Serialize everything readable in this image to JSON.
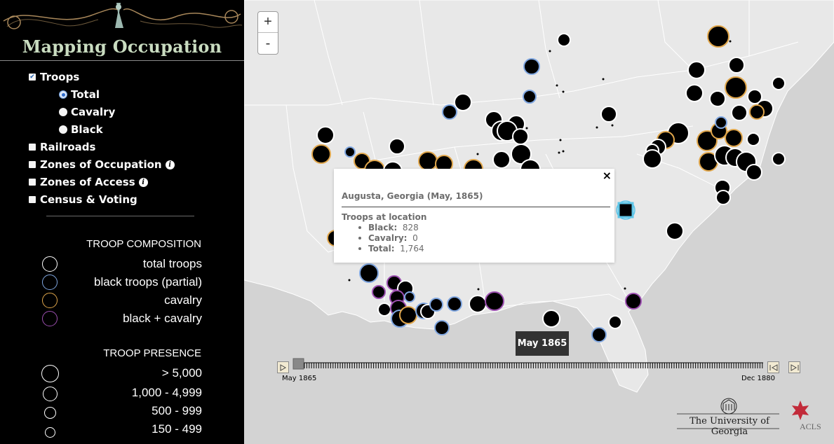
{
  "app": {
    "title": "Mapping Occupation"
  },
  "layers": {
    "troops": {
      "label": "Troops",
      "checked": true
    },
    "troop_options": [
      {
        "label": "Total",
        "selected": true
      },
      {
        "label": "Cavalry",
        "selected": false
      },
      {
        "label": "Black",
        "selected": false
      }
    ],
    "railroads": {
      "label": "Railroads",
      "checked": false
    },
    "zones_occupation": {
      "label": "Zones of Occupation",
      "checked": false,
      "info": "i"
    },
    "zones_access": {
      "label": "Zones of Access",
      "checked": false,
      "info": "i"
    },
    "census_voting": {
      "label": "Census & Voting",
      "checked": false
    }
  },
  "legend": {
    "composition_heading": "TROOP COMPOSITION",
    "composition": [
      {
        "label": "total troops",
        "color": "#ffffff"
      },
      {
        "label": "black troops (partial)",
        "color": "#7fa6e0"
      },
      {
        "label": "cavalry",
        "color": "#e0a64b"
      },
      {
        "label": "black + cavalry",
        "color": "#9c4fb0"
      }
    ],
    "presence_heading": "TROOP PRESENCE",
    "presence": [
      {
        "label": "> 5,000"
      },
      {
        "label": "1,000 - 4,999"
      },
      {
        "label": "500 - 999"
      },
      {
        "label": "150 - 499"
      }
    ]
  },
  "map": {
    "zoom_in": "+",
    "zoom_out": "-",
    "colors": {
      "land": "#e6e6e6",
      "water": "#cfcfcf",
      "border": "#ffffff",
      "marker": "#000000",
      "blue_ring": "#7fa6e0",
      "orange_ring": "#e0a64b",
      "purple_ring": "#9c4fb0",
      "white_ring": "#ffffff",
      "selected": "#5fc6e8"
    }
  },
  "popup": {
    "close": "×",
    "title": "Augusta, Georgia (May, 1865)",
    "subtitle": "Troops at location",
    "rows": [
      {
        "key": "Black:",
        "value": "828"
      },
      {
        "key": "Cavalry:",
        "value": "0"
      },
      {
        "key": "Total:",
        "value": "1,764"
      }
    ]
  },
  "timeline": {
    "current_label": "May 1865",
    "start_label": "May 1865",
    "end_label": "Dec 1880",
    "position": 0
  },
  "logos": {
    "uga": "The University of Georgia",
    "acls": "ACLS"
  }
}
